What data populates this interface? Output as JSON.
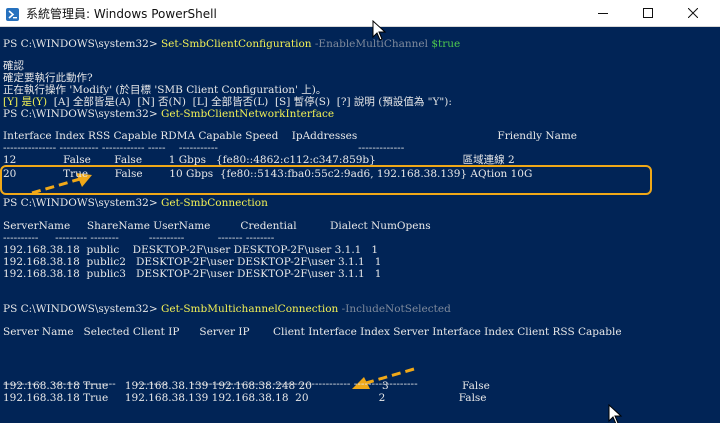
{
  "window": {
    "title": "系統管理員: Windows PowerShell",
    "accent": "#f0a818",
    "console_bg": "#012456"
  },
  "lines": [
    {
      "id": "l1",
      "parts": [
        {
          "t": "PS C:\\WINDOWS\\system32> "
        },
        {
          "t": "Set-SmbClientConfiguration",
          "c": "cmd"
        },
        {
          "t": " -EnableMultiChannel ",
          "c": "param"
        },
        {
          "t": "$true",
          "c": "var"
        }
      ]
    },
    {
      "id": "l2",
      "parts": [
        {
          "t": "確認"
        }
      ]
    },
    {
      "id": "l3",
      "parts": [
        {
          "t": "確定要執行此動作?"
        }
      ]
    },
    {
      "id": "l4",
      "parts": [
        {
          "t": "正在執行操作 'Modify' (於目標 'SMB Client Configuration' 上)。"
        }
      ]
    },
    {
      "id": "l5",
      "parts": [
        {
          "t": "[Y] 是(Y)",
          "c": "yellow"
        },
        {
          "t": "  [A] 全部皆是(A)  [N] 否(N)  [L] 全部皆否(L)  [S] 暫停(S)  [?] 說明 (預設值為 \"Y\"):"
        }
      ]
    },
    {
      "id": "l6",
      "parts": [
        {
          "t": "PS C:\\WINDOWS\\system32> "
        },
        {
          "t": "Get-SmbClientNetworkInterface",
          "c": "cmd"
        }
      ]
    },
    {
      "id": "l7",
      "parts": [
        {
          "t": "Interface Index RSS Capable RDMA Capable Speed    IpAddresses                                          Friendly Name"
        }
      ]
    },
    {
      "id": "l8",
      "parts": [
        {
          "t": "--------------- ----------- ------------ -----    -----------                                          -------------"
        }
      ]
    },
    {
      "id": "l9",
      "parts": [
        {
          "t": "12              False       False        1 Gbps   {fe80::4862:c112:c347:859b}                          區域連線 2"
        }
      ]
    },
    {
      "id": "l10",
      "parts": [
        {
          "t": "20              True        False        10 Gbps  {fe80::5143:fba0:55c2:9ad6, 192.168.38.139} AQtion 10G"
        }
      ]
    },
    {
      "id": "l11",
      "parts": [
        {
          "t": "PS C:\\WINDOWS\\system32> "
        },
        {
          "t": "Get-SmbConnection",
          "c": "cmd"
        }
      ]
    },
    {
      "id": "l12",
      "parts": [
        {
          "t": "ServerName     ShareName UserName         Credential          Dialect NumOpens"
        }
      ]
    },
    {
      "id": "l13",
      "parts": [
        {
          "t": "----------     --------- --------         ----------          ------- --------"
        }
      ]
    },
    {
      "id": "l14",
      "parts": [
        {
          "t": "192.168.38.18  public    DESKTOP-2F\\user DESKTOP-2F\\user 3.1.1   1"
        }
      ]
    },
    {
      "id": "l15",
      "parts": [
        {
          "t": "192.168.38.18  public2   DESKTOP-2F\\user DESKTOP-2F\\user 3.1.1   1"
        }
      ]
    },
    {
      "id": "l16",
      "parts": [
        {
          "t": "192.168.38.18  public3   DESKTOP-2F\\user DESKTOP-2F\\user 3.1.1   1"
        }
      ]
    },
    {
      "id": "l17",
      "parts": [
        {
          "t": "PS C:\\WINDOWS\\system32> "
        },
        {
          "t": "Get-SmbMultichannelConnection",
          "c": "cmd"
        },
        {
          "t": " -IncludeNotSelected",
          "c": "param"
        }
      ]
    },
    {
      "id": "l18",
      "parts": [
        {
          "t": "Server Name   Selected Client IP      Server IP       Client Interface Index Server Interface Index Client RSS Capable"
        }
      ]
    },
    {
      "id": "l19",
      "parts": [
        {
          "t": "-----------   -------- ---------      ---------       ---------------------- ---------------------- ------------------"
        }
      ]
    },
    {
      "id": "l20",
      "parts": [
        {
          "t": "192.168.38.18 True     192.168.38.139 192.168.38.248 20                     3                      False"
        }
      ]
    },
    {
      "id": "l21",
      "parts": [
        {
          "t": "192.168.38.18 True     192.168.38.139 192.168.38.18  20                     2                      False"
        }
      ]
    }
  ]
}
